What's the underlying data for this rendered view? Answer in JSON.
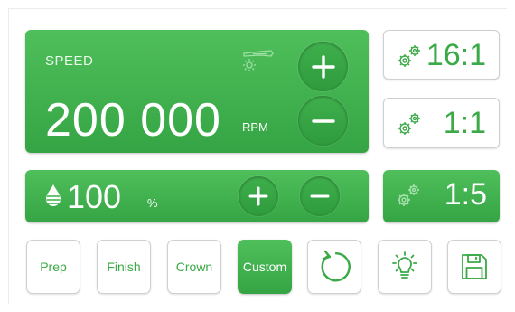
{
  "speed": {
    "label": "SPEED",
    "value": "200 000",
    "unit": "RPM"
  },
  "coolant": {
    "value": "100",
    "unit": "%"
  },
  "ratios": [
    {
      "label": "16:1",
      "selected": false
    },
    {
      "label": "1:1",
      "selected": false
    },
    {
      "label": "1:5",
      "selected": true
    }
  ],
  "modes": [
    {
      "label": "Prep",
      "selected": false
    },
    {
      "label": "Finish",
      "selected": false
    },
    {
      "label": "Crown",
      "selected": false
    },
    {
      "label": "Custom",
      "selected": true
    }
  ],
  "icons": [
    "handpiece-light-icon",
    "plus-icon",
    "minus-icon",
    "water-drop-icon",
    "gears-icon",
    "rotate-icon",
    "light-bulb-icon",
    "save-icon"
  ],
  "colors": {
    "accent": "#3aa946",
    "panel": "#43b451",
    "outline": "#cfcfcf"
  }
}
